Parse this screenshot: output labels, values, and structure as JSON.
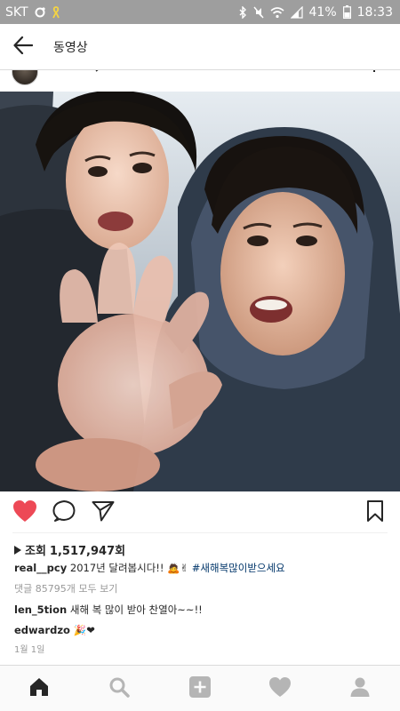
{
  "status_bar": {
    "carrier": "SKT",
    "battery": "41%",
    "time": "18:33",
    "icons": [
      "skt-ring-icon",
      "notification-ribbon-icon",
      "bluetooth-icon",
      "silent-icon",
      "wifi-icon",
      "signal-icon",
      "battery-icon"
    ]
  },
  "header": {
    "title": "동영상",
    "back_icon": "arrow-left-icon"
  },
  "post": {
    "media_type": "video",
    "actions": {
      "like_icon": "heart-filled-icon",
      "comment_icon": "comment-bubble-icon",
      "share_icon": "send-paper-plane-icon",
      "save_icon": "bookmark-icon",
      "like_color": "#ed4956"
    },
    "views": {
      "label": "조회",
      "count": "1,517,947회"
    },
    "caption": {
      "username": "real__pcy",
      "text": "2017년 달려봅시다!!",
      "emoji": "🙇✌",
      "hashtag": "#새해복많이받으세요"
    },
    "view_all_comments": "댓글 85795개 모두 보기",
    "comments": [
      {
        "username": "len_5tion",
        "text": "새해 복 많이 받아 찬열아~~!!"
      },
      {
        "username": "edwardzo",
        "text": "🎉❤"
      }
    ],
    "date": "1월 1일"
  },
  "bottom_nav": {
    "items": [
      {
        "icon": "home-icon",
        "active": true
      },
      {
        "icon": "search-icon",
        "active": false
      },
      {
        "icon": "add-post-icon",
        "active": false
      },
      {
        "icon": "activity-heart-icon",
        "active": false
      },
      {
        "icon": "profile-icon",
        "active": false
      }
    ]
  },
  "colors": {
    "status_bar_bg": "#9e9e9e",
    "like_red": "#ed4956",
    "hashtag_blue": "#003569",
    "muted_text": "#999999"
  }
}
